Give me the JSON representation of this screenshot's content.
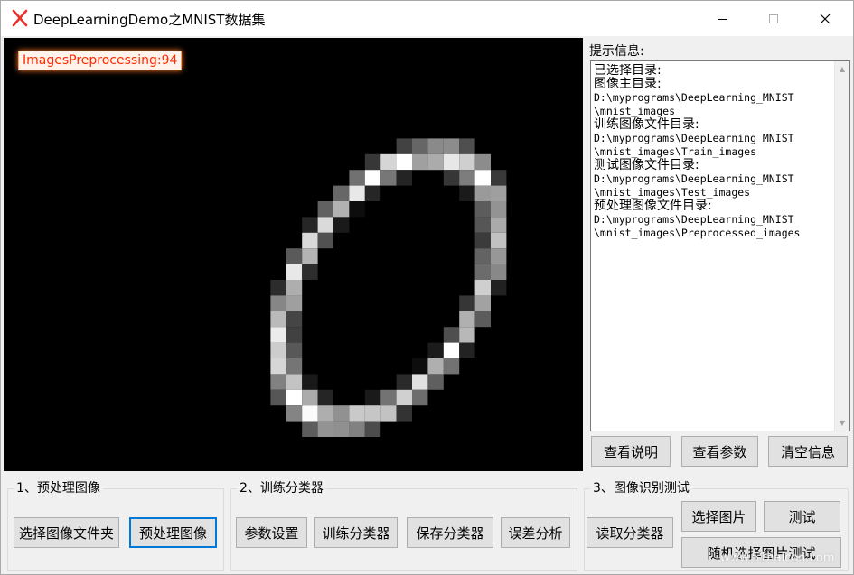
{
  "window": {
    "title": "DeepLearningDemo之MNIST数据集",
    "min_glyph": "—",
    "max_glyph": "☐",
    "close_glyph": "✕"
  },
  "canvas": {
    "overlay_label": "ImagesPreprocessing:94"
  },
  "info": {
    "caption": "提示信息:",
    "lines": [
      {
        "text": "已选择目录:",
        "zh": true
      },
      {
        "text": "图像主目录:",
        "zh": true
      },
      {
        "text": "D:\\myprograms\\DeepLearning_MNIST",
        "zh": false
      },
      {
        "text": "\\mnist_images",
        "zh": false
      },
      {
        "text": "训练图像文件目录:",
        "zh": true
      },
      {
        "text": "D:\\myprograms\\DeepLearning_MNIST",
        "zh": false
      },
      {
        "text": "\\mnist_images\\Train_images",
        "zh": false
      },
      {
        "text": "测试图像文件目录:",
        "zh": true
      },
      {
        "text": "D:\\myprograms\\DeepLearning_MNIST",
        "zh": false
      },
      {
        "text": "\\mnist_images\\Test_images",
        "zh": false
      },
      {
        "text": "预处理图像文件目录:",
        "zh": true
      },
      {
        "text": "D:\\myprograms\\DeepLearning_MNIST",
        "zh": false
      },
      {
        "text": "\\mnist_images\\Preprocessed_images",
        "zh": false
      }
    ]
  },
  "info_buttons": {
    "view_help": "查看说明",
    "view_params": "查看参数",
    "clear_info": "清空信息"
  },
  "group1": {
    "title": "1、预处理图像",
    "select_folder": "选择图像文件夹",
    "preprocess": "预处理图像"
  },
  "group2": {
    "title": "2、训练分类器",
    "param_settings": "参数设置",
    "train": "训练分类器",
    "save": "保存分类器",
    "error_analysis": "误差分析"
  },
  "group3": {
    "title": "3、图像识别测试",
    "read_classifier": "读取分类器",
    "select_image": "选择图片",
    "test": "测试",
    "random_test": "随机选择图片测试"
  },
  "watermark": "www.51halcon.com",
  "colors": {
    "accent": "#0078d7",
    "app_icon": "#e8312a",
    "overlay_text": "#ff2a00"
  }
}
